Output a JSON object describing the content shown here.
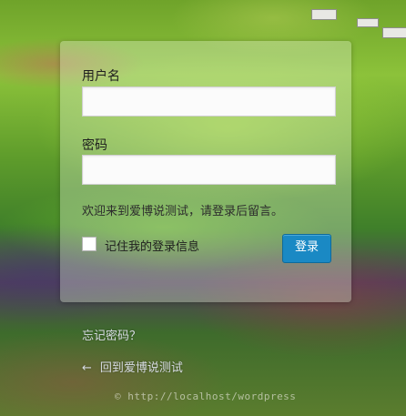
{
  "login_form": {
    "username_label": "用户名",
    "username_value": "",
    "password_label": "密码",
    "password_value": "",
    "welcome_message": "欢迎来到爱博说测试，请登录后留言。",
    "remember_label": "记住我的登录信息",
    "remember_checked": false,
    "submit_label": "登录",
    "submit_color": "#1a89c4"
  },
  "links": {
    "lost_password": "忘记密码？",
    "back_arrow": "←",
    "back_to_site": "回到爱博说测试"
  },
  "watermark": {
    "url": "© http://localhost/wordpress"
  }
}
